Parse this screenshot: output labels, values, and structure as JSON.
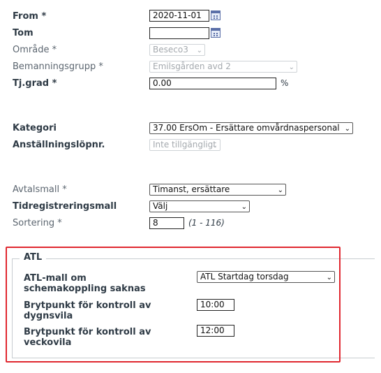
{
  "form": {
    "from": {
      "label": "From *",
      "value": "2020-11-01"
    },
    "tom": {
      "label": "Tom",
      "value": ""
    },
    "omrade": {
      "label": "Område *",
      "value": "Beseco3"
    },
    "bemanningsgrupp": {
      "label": "Bemanningsgrupp *",
      "value": "Emilsgården avd 2"
    },
    "tjgrad": {
      "label": "Tj.grad *",
      "value": "0.00",
      "unit": "%"
    },
    "kategori": {
      "label": "Kategori",
      "value": "37.00 ErsOm - Ersättare omvårdnaspersonal"
    },
    "anstallningslopnr": {
      "label": "Anställningslöpnr.",
      "value": "Inte tillgängligt"
    },
    "avtalsmall": {
      "label": "Avtalsmall *",
      "value": "Timanst, ersättare"
    },
    "tidregistreringsmall": {
      "label": "Tidregistreringsmall",
      "value": "Välj"
    },
    "sortering": {
      "label": "Sortering *",
      "value": "8",
      "hint": "(1 - 116)"
    }
  },
  "atl": {
    "legend": "ATL",
    "mall": {
      "label_line1": "ATL-mall om",
      "label_line2": "schemakoppling saknas",
      "value": "ATL Startdag torsdag"
    },
    "dygnsvila": {
      "label_line1": "Brytpunkt för kontroll av",
      "label_line2": "dygnsvila",
      "value": "10:00"
    },
    "veckovila": {
      "label_line1": "Brytpunkt för kontroll av",
      "label_line2": "veckovila",
      "value": "12:00"
    }
  },
  "highlight_color": "#e0272f"
}
